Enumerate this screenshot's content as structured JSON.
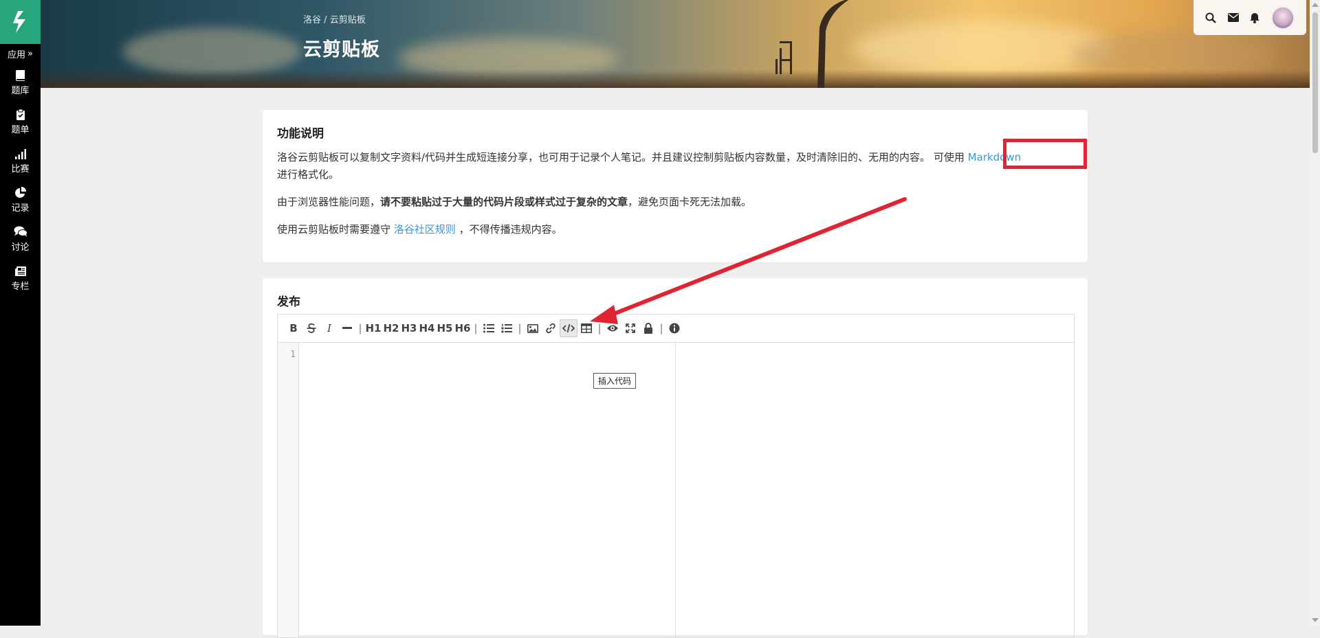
{
  "sidebar": {
    "logo": "luogu-logo",
    "apps_label": "应用",
    "items": [
      {
        "label": "题库",
        "icon": "book-icon"
      },
      {
        "label": "题单",
        "icon": "clipboard-icon"
      },
      {
        "label": "比赛",
        "icon": "bar-chart-icon"
      },
      {
        "label": "记录",
        "icon": "pie-chart-icon"
      },
      {
        "label": "讨论",
        "icon": "comments-icon"
      },
      {
        "label": "专栏",
        "icon": "newspaper-icon"
      }
    ]
  },
  "header": {
    "breadcrumb": [
      "洛谷",
      "/",
      "云剪贴板"
    ],
    "title": "云剪贴板"
  },
  "userbar": {
    "icons": [
      "search-icon",
      "envelope-icon",
      "bell-icon"
    ]
  },
  "intro": {
    "title": "功能说明",
    "p1_text": "洛谷云剪贴板可以复制文字资料/代码并生成短连接分享，也可用于记录个人笔记。并且建议控制剪贴板内容数量，及时清除旧的、无用的内容。 可使用",
    "p1_link": "Markdown",
    "p1_tail": "进行格式化。",
    "p2_pre": "由于浏览器性能问题，",
    "p2_bold": "请不要粘贴过于大量的代码片段或样式过于复杂的文章",
    "p2_post": "，避免页面卡死无法加载。",
    "p3_pre": "使用云剪贴板时需要遵守",
    "p3_link": "洛谷社区规则",
    "p3_post": "，不得传播违规内容。"
  },
  "publish": {
    "title": "发布",
    "toolbar": {
      "bold": "B",
      "italic": "I",
      "h1": "H1",
      "h2": "H2",
      "h3": "H3",
      "h4": "H4",
      "h5": "H5",
      "h6": "H6",
      "sep": "|"
    },
    "line_number": "1",
    "tooltip": "插入代码"
  },
  "colors": {
    "sidebar_bg": "#000000",
    "logo_bg": "#27a57c",
    "link": "#3498db",
    "annotation_red": "#e02431"
  }
}
